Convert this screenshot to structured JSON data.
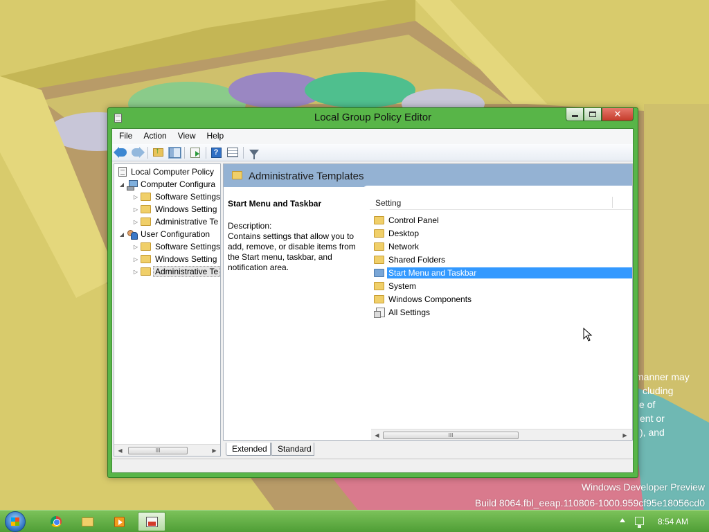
{
  "desktop": {
    "watermark_line1": "Windows Developer Preview",
    "watermark_line2": "Build 8064.fbl_eeap.110806-1000.959cf95e18056cd0",
    "behind_text": [
      "manner may",
      "cluding",
      "e of",
      "ent or",
      "), and"
    ]
  },
  "window": {
    "title": "Local Group Policy Editor",
    "minimize_label": "minimize",
    "close_label": "✕"
  },
  "menu": {
    "items": [
      "File",
      "Action",
      "View",
      "Help"
    ]
  },
  "toolbar": {
    "icons": [
      "back-icon",
      "forward-icon",
      "up-folder-icon",
      "show-hide-tree-icon",
      "export-list-icon",
      "help-icon",
      "properties-icon",
      "filter-icon"
    ]
  },
  "tree": {
    "root": "Local Computer Policy",
    "items": [
      {
        "label": "Computer Configura",
        "level": 1,
        "expander": "◢"
      },
      {
        "label": "Software Settings",
        "level": 2,
        "expander": "▷"
      },
      {
        "label": "Windows Setting",
        "level": 2,
        "expander": "▷"
      },
      {
        "label": "Administrative Te",
        "level": 2,
        "expander": "▷"
      },
      {
        "label": "User Configuration",
        "level": 1,
        "expander": "◢"
      },
      {
        "label": "Software Settings",
        "level": 2,
        "expander": "▷"
      },
      {
        "label": "Windows Setting",
        "level": 2,
        "expander": "▷"
      },
      {
        "label": "Administrative Te",
        "level": 2,
        "expander": "▷"
      }
    ],
    "scroll_thumb": "III"
  },
  "details": {
    "header": "Administrative Templates",
    "selected_title": "Start Menu and Taskbar",
    "description_label": "Description:",
    "description_text": "Contains settings that allow you to add, remove, or disable items from the Start menu, taskbar, and notification area.",
    "column_header": "Setting",
    "rows": [
      {
        "label": "Control Panel",
        "icon": "folder-icon",
        "selected": false
      },
      {
        "label": "Desktop",
        "icon": "folder-icon",
        "selected": false
      },
      {
        "label": "Network",
        "icon": "folder-icon",
        "selected": false
      },
      {
        "label": "Shared Folders",
        "icon": "folder-icon",
        "selected": false
      },
      {
        "label": "Start Menu and Taskbar",
        "icon": "folder-icon",
        "selected": true
      },
      {
        "label": "System",
        "icon": "folder-icon",
        "selected": false
      },
      {
        "label": "Windows Components",
        "icon": "folder-icon",
        "selected": false
      },
      {
        "label": "All Settings",
        "icon": "all-settings-icon",
        "selected": false
      }
    ],
    "scroll_thumb": "III"
  },
  "tabs": {
    "extended": "Extended",
    "standard": "Standard"
  },
  "taskbar": {
    "clock": "8:54 AM",
    "apps": [
      "chrome-icon",
      "explorer-icon",
      "media-player-icon",
      "group-policy-editor-icon"
    ]
  },
  "colors": {
    "window_frame": "#58b548",
    "selection": "#3399ff",
    "header_band": "#94b2d3",
    "taskbar": "#5fae42"
  }
}
